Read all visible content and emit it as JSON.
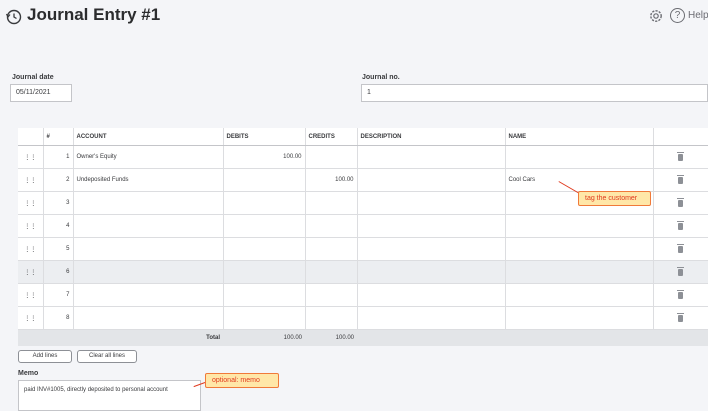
{
  "header": {
    "title": "Journal Entry #1",
    "help_label": "Help"
  },
  "fields": {
    "journal_date_label": "Journal date",
    "journal_date_value": "05/11/2021",
    "journal_no_label": "Journal no.",
    "journal_no_value": "1"
  },
  "table": {
    "columns": [
      "",
      "#",
      "ACCOUNT",
      "DEBITS",
      "CREDITS",
      "DESCRIPTION",
      "NAME",
      ""
    ],
    "rows": [
      {
        "num": "1",
        "account": "Owner's Equity",
        "debits": "100.00",
        "credits": "",
        "description": "",
        "name": ""
      },
      {
        "num": "2",
        "account": "Undeposited Funds",
        "debits": "",
        "credits": "100.00",
        "description": "",
        "name": "Cool Cars"
      },
      {
        "num": "3",
        "account": "",
        "debits": "",
        "credits": "",
        "description": "",
        "name": ""
      },
      {
        "num": "4",
        "account": "",
        "debits": "",
        "credits": "",
        "description": "",
        "name": ""
      },
      {
        "num": "5",
        "account": "",
        "debits": "",
        "credits": "",
        "description": "",
        "name": ""
      },
      {
        "num": "6",
        "account": "",
        "debits": "",
        "credits": "",
        "description": "",
        "name": ""
      },
      {
        "num": "7",
        "account": "",
        "debits": "",
        "credits": "",
        "description": "",
        "name": ""
      },
      {
        "num": "8",
        "account": "",
        "debits": "",
        "credits": "",
        "description": "",
        "name": ""
      }
    ],
    "total_label": "Total",
    "total_debits": "100.00",
    "total_credits": "100.00"
  },
  "buttons": {
    "add_lines": "Add lines",
    "clear_all_lines": "Clear all lines"
  },
  "memo": {
    "label": "Memo",
    "value": "paid INV#1005, directly deposited to personal account"
  },
  "annotations": {
    "tag_customer": "tag the customer",
    "optional_memo": "optional: memo"
  },
  "icons": {
    "history": "history-icon",
    "gear": "gear-icon",
    "help": "help-icon",
    "drag": "drag-handle-icon",
    "trash": "trash-icon"
  },
  "colors": {
    "callout_fill": "#ffe7a8",
    "callout_text": "#e03a1e",
    "callout_border": "#f07a3a"
  }
}
